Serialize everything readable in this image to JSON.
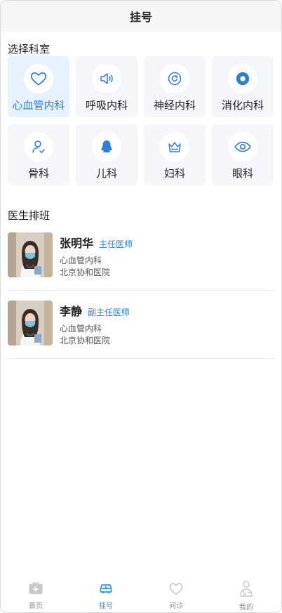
{
  "header": {
    "title": "挂号"
  },
  "departments": {
    "section_title": "选择科室",
    "items": [
      {
        "label": "心血管内科",
        "icon": "heart-icon",
        "active": true
      },
      {
        "label": "呼吸内科",
        "icon": "speaker-icon",
        "active": false
      },
      {
        "label": "神经内科",
        "icon": "refresh-icon",
        "active": false
      },
      {
        "label": "消化内科",
        "icon": "dot-circle-icon",
        "active": false
      },
      {
        "label": "骨科",
        "icon": "user-check-icon",
        "active": false
      },
      {
        "label": "儿科",
        "icon": "child-icon",
        "active": false
      },
      {
        "label": "妇科",
        "icon": "crown-icon",
        "active": false
      },
      {
        "label": "眼科",
        "icon": "eye-icon",
        "active": false
      }
    ]
  },
  "schedule": {
    "section_title": "医生排班",
    "doctors": [
      {
        "name": "张明华",
        "title": "主任医师",
        "department": "心血管内科",
        "hospital": "北京协和医院"
      },
      {
        "name": "李静",
        "title": "副主任医师",
        "department": "心血管内科",
        "hospital": "北京协和医院"
      }
    ]
  },
  "tabbar": {
    "items": [
      {
        "label": "首页",
        "icon": "medkit-icon",
        "active": false
      },
      {
        "label": "挂号",
        "icon": "ambulance-icon",
        "active": true
      },
      {
        "label": "问诊",
        "icon": "heart-outline-icon",
        "active": false
      },
      {
        "label": "我的",
        "icon": "doctor-icon",
        "active": false
      }
    ]
  },
  "colors": {
    "accent": "#2e7dd7",
    "tab_active": "#2d95e5",
    "card_bg": "#f5f6fa",
    "active_card_bg": "#e6f2ff"
  }
}
